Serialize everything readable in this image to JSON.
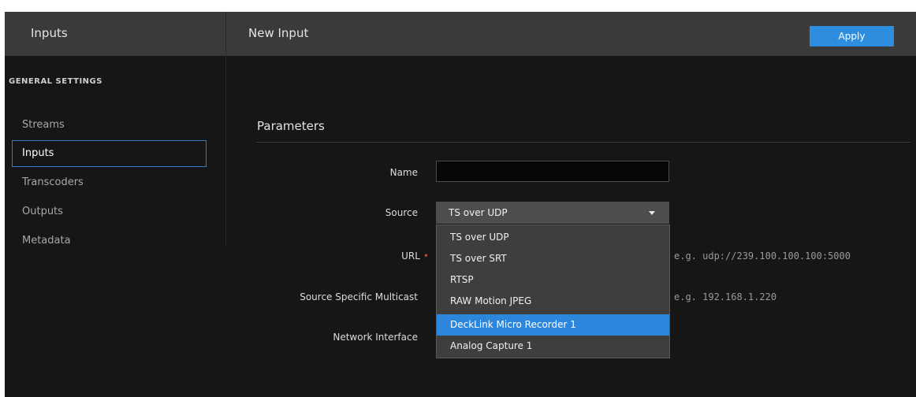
{
  "header": {
    "app_title": "Inputs",
    "page_title": "New Input",
    "apply_label": "Apply",
    "apply_color": "#2d8ee0"
  },
  "sidebar": {
    "section_title": "GENERAL SETTINGS",
    "items": [
      {
        "label": "Streams",
        "active": false
      },
      {
        "label": "Inputs",
        "active": true
      },
      {
        "label": "Transcoders",
        "active": false
      },
      {
        "label": "Outputs",
        "active": false
      },
      {
        "label": "Metadata",
        "active": false
      }
    ]
  },
  "form": {
    "section_title": "Parameters",
    "name_label": "Name",
    "name_value": "",
    "source_label": "Source",
    "source_value": "TS over UDP",
    "url_label": "URL",
    "url_required": "•",
    "url_hint": "e.g. udp://239.100.100.100:5000",
    "ssm_label": "Source Specific Multicast",
    "ssm_hint": "e.g. 192.168.1.220",
    "network_interface_label": "Network Interface"
  },
  "dropdown": {
    "options": [
      {
        "label": "TS over UDP",
        "highlighted": false
      },
      {
        "label": "TS over SRT",
        "highlighted": false
      },
      {
        "label": "RTSP",
        "highlighted": false
      },
      {
        "label": "RAW Motion JPEG",
        "highlighted": false
      },
      {
        "label": "DeckLink Micro Recorder 1",
        "highlighted": true
      },
      {
        "label": "Analog Capture 1",
        "highlighted": false
      }
    ],
    "highlight_color": "#2c86dc"
  }
}
